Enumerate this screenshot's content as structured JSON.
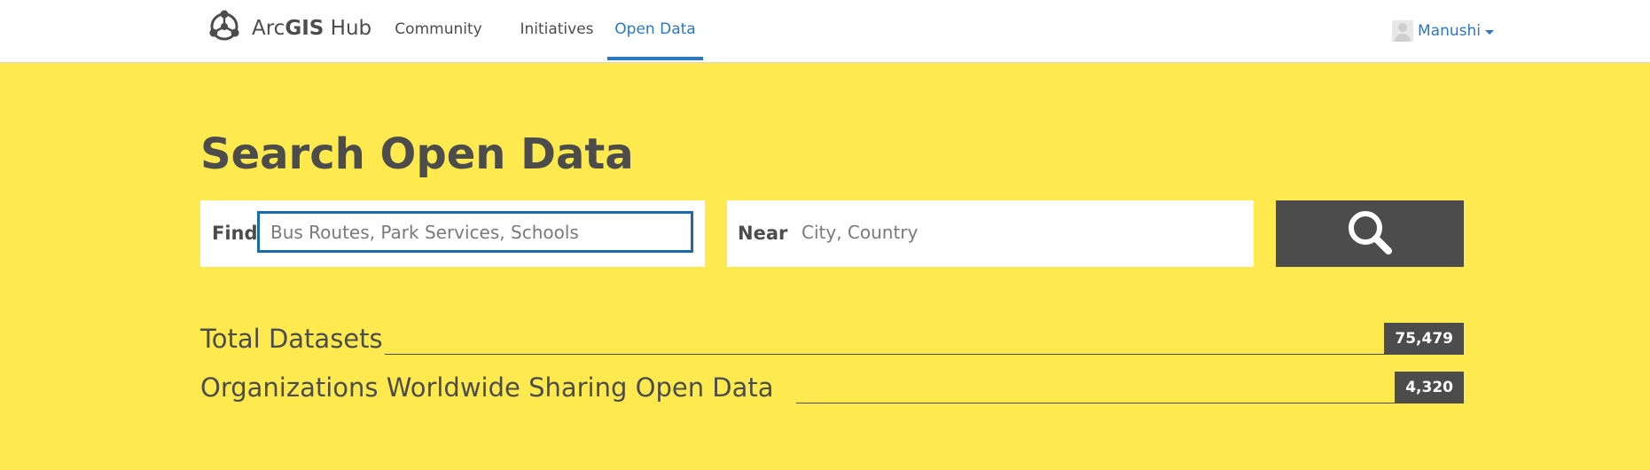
{
  "nav": {
    "brand_prefix": "Arc",
    "brand_bold": "GIS",
    "brand_suffix": " Hub",
    "links": [
      {
        "label": "Community"
      },
      {
        "label": "Initiatives"
      },
      {
        "label": "Open Data",
        "active": true
      }
    ],
    "user": {
      "name": "Manushi"
    }
  },
  "hero": {
    "title": "Search Open Data",
    "find": {
      "label": "Find",
      "placeholder": "Bus Routes, Park Services, Schools",
      "value": ""
    },
    "near": {
      "label": "Near",
      "placeholder": "City, Country",
      "value": ""
    }
  },
  "stats": [
    {
      "label": "Total Datasets",
      "value": "75,479"
    },
    {
      "label": "Organizations Worldwide Sharing Open Data",
      "value": "4,320"
    }
  ],
  "colors": {
    "accent": "#2a78be",
    "hero_background": "#feea4e",
    "dark": "#4c4c4c",
    "focus_border": "#1b6aae"
  },
  "icons": {
    "brand": "hub-logo-icon",
    "search": "search-icon",
    "user_avatar": "user-avatar-icon",
    "menu_caret": "caret-down-icon"
  }
}
